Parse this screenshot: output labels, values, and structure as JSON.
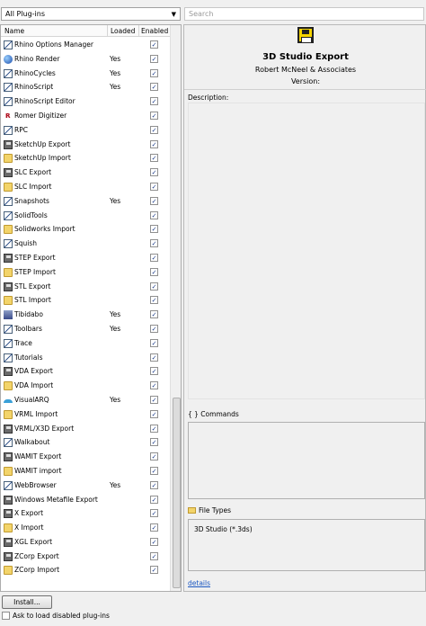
{
  "filter": {
    "selected": "All Plug-ins"
  },
  "search": {
    "placeholder": "Search"
  },
  "list": {
    "headers": {
      "name": "Name",
      "loaded": "Loaded",
      "enabled": "Enabled"
    },
    "rows": [
      {
        "name": "Rhino Options Manager",
        "loaded": "",
        "enabled": true,
        "icon": "plugin-icon"
      },
      {
        "name": "Rhino Render",
        "loaded": "Yes",
        "enabled": true,
        "icon": "render-sphere-icon"
      },
      {
        "name": "RhinoCycles",
        "loaded": "Yes",
        "enabled": true,
        "icon": "plugin-icon"
      },
      {
        "name": "RhinoScript",
        "loaded": "Yes",
        "enabled": true,
        "icon": "plugin-icon"
      },
      {
        "name": "RhinoScript Editor",
        "loaded": "",
        "enabled": true,
        "icon": "plugin-icon"
      },
      {
        "name": "Romer Digitizer",
        "loaded": "",
        "enabled": true,
        "icon": "romer-icon"
      },
      {
        "name": "RPC",
        "loaded": "",
        "enabled": true,
        "icon": "plugin-icon"
      },
      {
        "name": "SketchUp Export",
        "loaded": "",
        "enabled": true,
        "icon": "disk-icon"
      },
      {
        "name": "SketchUp Import",
        "loaded": "",
        "enabled": true,
        "icon": "folder-icon"
      },
      {
        "name": "SLC Export",
        "loaded": "",
        "enabled": true,
        "icon": "disk-icon"
      },
      {
        "name": "SLC Import",
        "loaded": "",
        "enabled": true,
        "icon": "folder-icon"
      },
      {
        "name": "Snapshots",
        "loaded": "Yes",
        "enabled": true,
        "icon": "plugin-icon"
      },
      {
        "name": "SolidTools",
        "loaded": "",
        "enabled": true,
        "icon": "plugin-icon"
      },
      {
        "name": "Solidworks Import",
        "loaded": "",
        "enabled": true,
        "icon": "folder-icon"
      },
      {
        "name": "Squish",
        "loaded": "",
        "enabled": true,
        "icon": "plugin-icon"
      },
      {
        "name": "STEP Export",
        "loaded": "",
        "enabled": true,
        "icon": "disk-icon"
      },
      {
        "name": "STEP Import",
        "loaded": "",
        "enabled": true,
        "icon": "folder-icon"
      },
      {
        "name": "STL Export",
        "loaded": "",
        "enabled": true,
        "icon": "disk-icon"
      },
      {
        "name": "STL Import",
        "loaded": "",
        "enabled": true,
        "icon": "folder-icon"
      },
      {
        "name": "Tibidabo",
        "loaded": "Yes",
        "enabled": true,
        "icon": "tibidabo-icon"
      },
      {
        "name": "Toolbars",
        "loaded": "Yes",
        "enabled": true,
        "icon": "plugin-icon"
      },
      {
        "name": "Trace",
        "loaded": "",
        "enabled": true,
        "icon": "plugin-icon"
      },
      {
        "name": "Tutorials",
        "loaded": "",
        "enabled": true,
        "icon": "plugin-icon"
      },
      {
        "name": "VDA Export",
        "loaded": "",
        "enabled": true,
        "icon": "disk-icon"
      },
      {
        "name": "VDA Import",
        "loaded": "",
        "enabled": true,
        "icon": "folder-icon"
      },
      {
        "name": "VisualARQ",
        "loaded": "Yes",
        "enabled": true,
        "icon": "visualarq-icon"
      },
      {
        "name": "VRML Import",
        "loaded": "",
        "enabled": true,
        "icon": "folder-icon"
      },
      {
        "name": "VRML/X3D Export",
        "loaded": "",
        "enabled": true,
        "icon": "disk-icon"
      },
      {
        "name": "Walkabout",
        "loaded": "",
        "enabled": true,
        "icon": "plugin-icon"
      },
      {
        "name": "WAMIT Export",
        "loaded": "",
        "enabled": true,
        "icon": "disk-icon"
      },
      {
        "name": "WAMIT import",
        "loaded": "",
        "enabled": true,
        "icon": "folder-icon"
      },
      {
        "name": "WebBrowser",
        "loaded": "Yes",
        "enabled": true,
        "icon": "plugin-icon"
      },
      {
        "name": "Windows Metafile Export",
        "loaded": "",
        "enabled": true,
        "icon": "disk-icon"
      },
      {
        "name": "X Export",
        "loaded": "",
        "enabled": true,
        "icon": "disk-icon"
      },
      {
        "name": "X Import",
        "loaded": "",
        "enabled": true,
        "icon": "folder-icon"
      },
      {
        "name": "XGL Export",
        "loaded": "",
        "enabled": true,
        "icon": "disk-icon"
      },
      {
        "name": "ZCorp Export",
        "loaded": "",
        "enabled": true,
        "icon": "disk-icon"
      },
      {
        "name": "ZCorp Import",
        "loaded": "",
        "enabled": true,
        "icon": "folder-icon"
      }
    ]
  },
  "detail": {
    "title": "3D Studio Export",
    "author": "Robert McNeel & Associates",
    "version_label": "Version:",
    "description_label": "Description:",
    "commands_label": "{ }  Commands",
    "file_types_label": "File Types",
    "file_types": [
      "3D Studio (*.3ds)"
    ],
    "details_link": "details"
  },
  "footer": {
    "install_label": "Install...",
    "ask_label": "Ask to load disabled plug-ins",
    "ask_checked": false
  }
}
